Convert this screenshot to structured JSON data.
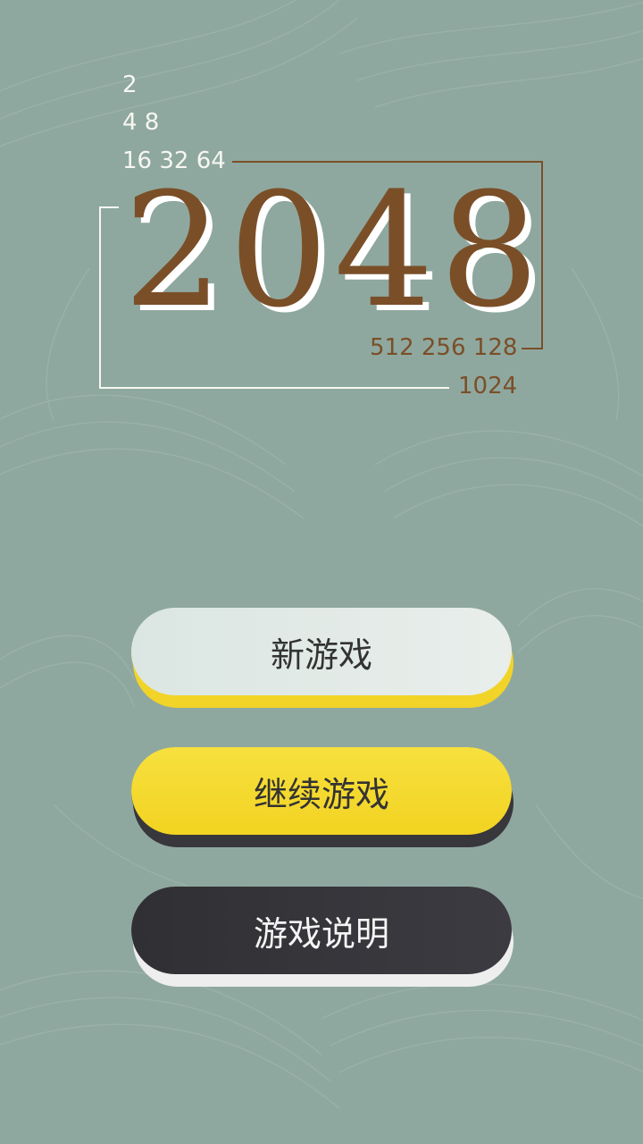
{
  "logo": {
    "row1": "2",
    "row2": "4 8",
    "row3": "16 32 64",
    "title": "2048",
    "row4": "512 256 128",
    "row5": "1024"
  },
  "menu": {
    "new_game": "新游戏",
    "continue_game": "继续游戏",
    "instructions": "游戏说明"
  },
  "colors": {
    "background": "#8fa89f",
    "title_brown": "#7a4f28",
    "yellow": "#f2d328",
    "dark": "#38373c",
    "light": "#dbe6e2"
  }
}
